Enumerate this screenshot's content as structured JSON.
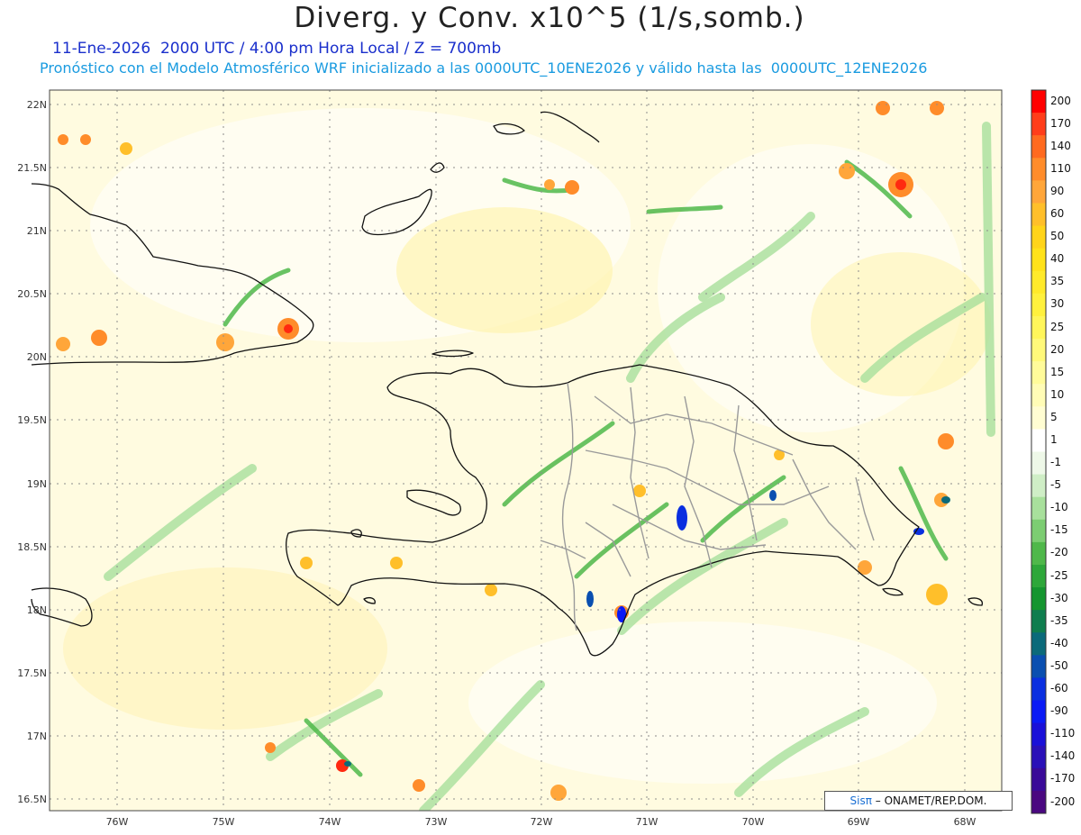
{
  "header": {
    "title": "Diverg. y Conv. x10^5 (1/s,somb.)",
    "line1": "11-Ene-2026  2000 UTC / 4:00 pm Hora Local / Z = 700mb",
    "line2": "Pronóstico con el Modelo Atmosférico WRF inicializado a las 0000UTC_10ENE2026 y válido hasta las  0000UTC_12ENE2026"
  },
  "axes": {
    "lat_labels": [
      "22N",
      "21.5N",
      "21N",
      "20.5N",
      "20N",
      "19.5N",
      "19N",
      "18.5N",
      "18N",
      "17.5N",
      "17N",
      "16.5N"
    ],
    "lon_labels": [
      "76W",
      "75W",
      "74W",
      "73W",
      "72W",
      "71W",
      "70W",
      "69W",
      "68W"
    ]
  },
  "colorbar": [
    {
      "label": "200",
      "color": "#ff0000"
    },
    {
      "label": "170",
      "color": "#ff3d1a"
    },
    {
      "label": "140",
      "color": "#ff6a1f"
    },
    {
      "label": "110",
      "color": "#ff8c2a"
    },
    {
      "label": "90",
      "color": "#ffa63a"
    },
    {
      "label": "60",
      "color": "#ffbf2a"
    },
    {
      "label": "50",
      "color": "#ffd41a"
    },
    {
      "label": "40",
      "color": "#ffe21a"
    },
    {
      "label": "35",
      "color": "#ffea2a"
    },
    {
      "label": "30",
      "color": "#fff13d"
    },
    {
      "label": "25",
      "color": "#fff65a"
    },
    {
      "label": "20",
      "color": "#fff97a"
    },
    {
      "label": "15",
      "color": "#fffb9a"
    },
    {
      "label": "10",
      "color": "#fffcb6"
    },
    {
      "label": "5",
      "color": "#fffdd2"
    },
    {
      "label": "1",
      "color": "#ffffff"
    },
    {
      "label": "-1",
      "color": "#eef8e8"
    },
    {
      "label": "-5",
      "color": "#cfeec6"
    },
    {
      "label": "-10",
      "color": "#a8e09c"
    },
    {
      "label": "-15",
      "color": "#7ccd72"
    },
    {
      "label": "-20",
      "color": "#4fb84a"
    },
    {
      "label": "-25",
      "color": "#2ea73a"
    },
    {
      "label": "-30",
      "color": "#15952f"
    },
    {
      "label": "-35",
      "color": "#0f7d4e"
    },
    {
      "label": "-40",
      "color": "#0b6a7a"
    },
    {
      "label": "-50",
      "color": "#0a4fb0"
    },
    {
      "label": "-60",
      "color": "#0a2fe0"
    },
    {
      "label": "-90",
      "color": "#0a1af5"
    },
    {
      "label": "-110",
      "color": "#1a10d8"
    },
    {
      "label": "-140",
      "color": "#2a10b8"
    },
    {
      "label": "-170",
      "color": "#3a0a98"
    },
    {
      "label": "-200",
      "color": "#4a0880"
    }
  ],
  "credit": {
    "sis": "Sisπ",
    "rest": "– ONAMET/REP.DOM."
  }
}
